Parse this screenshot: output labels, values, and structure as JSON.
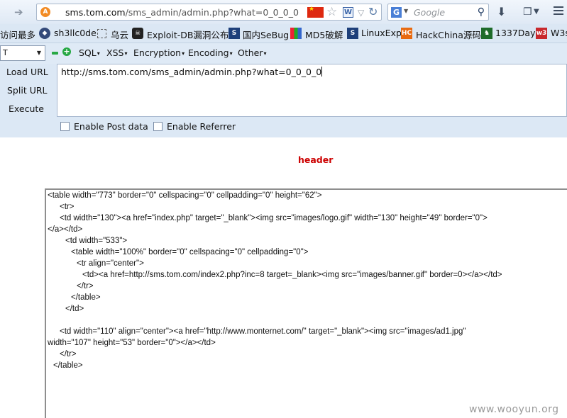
{
  "navbar": {
    "url_host": "sms.tom.com",
    "url_path": "/sms_admin/admin.php?what=0_0_0_0",
    "search_placeholder": "Google",
    "search_engine_icon": "G",
    "site_icon": "A",
    "w_icon": "W"
  },
  "bookmarks": [
    {
      "label": "访问最多",
      "icon": "none"
    },
    {
      "label": "sh3llc0de",
      "icon": "cube-icon"
    },
    {
      "label": "乌云",
      "icon": "dashed-folder-icon"
    },
    {
      "label": "Exploit-DB漏洞公布",
      "icon": "skull-icon"
    },
    {
      "label": "国内SeBug",
      "icon": "s-icon"
    },
    {
      "label": "MD5破解",
      "icon": "grid-icon"
    },
    {
      "label": "LinuxExp",
      "icon": "s-icon"
    },
    {
      "label": "HackChina源码",
      "icon": "hc-icon"
    },
    {
      "label": "1337Day",
      "icon": "shield-icon"
    },
    {
      "label": "W3s",
      "icon": "w3-icon"
    }
  ],
  "hackbar": {
    "select_value": "T",
    "menus": [
      "SQL",
      "XSS",
      "Encryption",
      "Encoding",
      "Other"
    ],
    "buttons": {
      "load": "Load URL",
      "split": "Split URL",
      "execute": "Execute"
    },
    "url_value": "http://sms.tom.com/sms_admin/admin.php?what=0_0_0_0",
    "checkboxes": {
      "post": "Enable Post data",
      "referrer": "Enable Referrer"
    }
  },
  "page": {
    "header": "header",
    "source_lines": [
      "<table width=\"773\" border=\"0\" cellspacing=\"0\" cellpadding=\"0\" height=\"62\">",
      "<tr>",
      "<td width=\"130\"><a href=\"index.php\" target=\"_blank\"><img src=\"images/logo.gif\" width=\"130\" height=\"49\" border=\"0\">",
      "</a></td>",
      "<td width=\"533\">",
      "<table width=\"100%\" border=\"0\" cellspacing=\"0\" cellpadding=\"0\">",
      "<tr align=\"center\">",
      "<td><a href=http://sms.tom.com/index2.php?inc=8 target=_blank><img src=\"images/banner.gif\" border=0></a></td>",
      "</tr>",
      "</table>",
      "</td>",
      "<td width=\"110\" align=\"center\"><a href=\"http://www.monternet.com/\" target=\"_blank\"><img src=\"images/ad1.jpg\"",
      "width=\"107\" height=\"53\" border=\"0\"></a></td>",
      "</tr>",
      "</table>"
    ],
    "watermark": "www.wooyun.org"
  }
}
